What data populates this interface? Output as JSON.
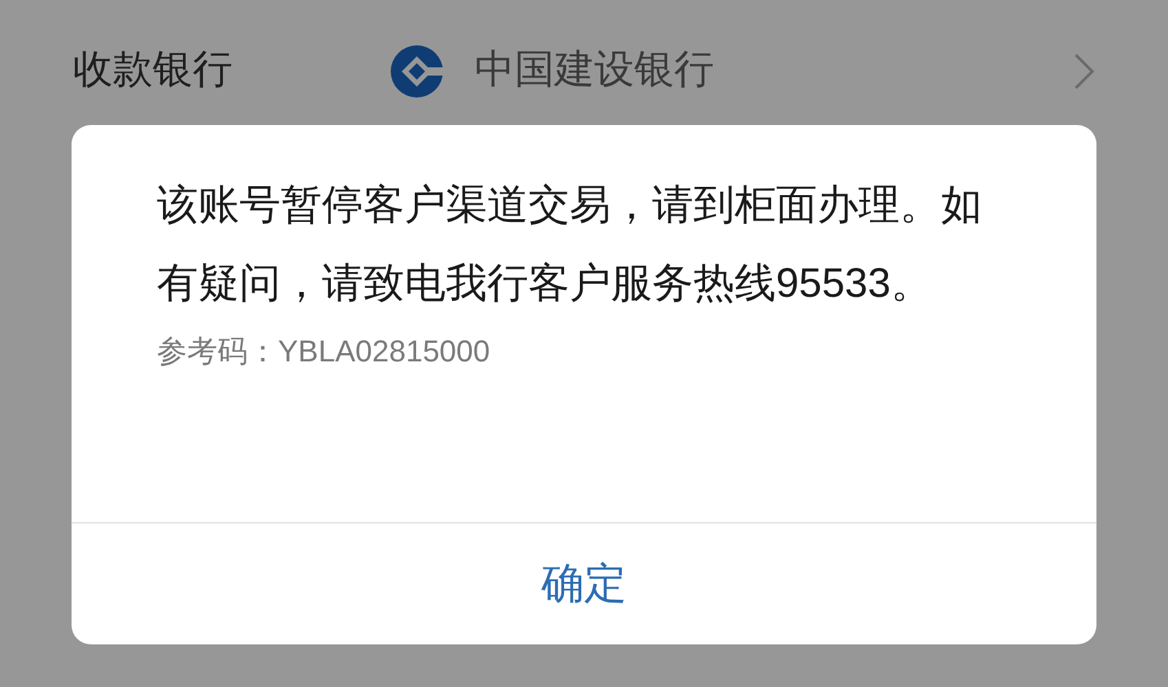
{
  "row": {
    "label": "收款银行",
    "bank_name": "中国建设银行"
  },
  "dialog": {
    "message": "该账号暂停客户渠道交易，请到柜面办理。如有疑问，请致电我行客户服务热线95533。",
    "reference": "参考码：YBLA02815000",
    "button": "确定"
  }
}
